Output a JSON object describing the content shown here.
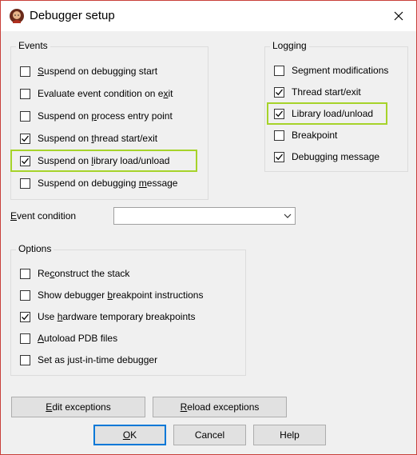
{
  "window": {
    "title": "Debugger setup"
  },
  "events": {
    "legend": "Events",
    "items": [
      {
        "pre": "",
        "u": "S",
        "post": "uspend on debugging start",
        "checked": false
      },
      {
        "pre": "Evaluate event condition on e",
        "u": "x",
        "post": "it",
        "checked": false
      },
      {
        "pre": "Suspend on ",
        "u": "p",
        "post": "rocess entry point",
        "checked": false
      },
      {
        "pre": "Suspend on ",
        "u": "t",
        "post": "hread start/exit",
        "checked": true
      },
      {
        "pre": "Suspend on ",
        "u": "l",
        "post": "ibrary load/unload",
        "checked": true
      },
      {
        "pre": "Suspend on debugging ",
        "u": "m",
        "post": "essage",
        "checked": false
      }
    ]
  },
  "logging": {
    "legend": "Logging",
    "items": [
      {
        "pre": "Segment modifications",
        "u": "",
        "post": "",
        "checked": false
      },
      {
        "pre": "Thread start/exit",
        "u": "",
        "post": "",
        "checked": true
      },
      {
        "pre": "Library load/unload",
        "u": "",
        "post": "",
        "checked": true
      },
      {
        "pre": "Breakpoint",
        "u": "",
        "post": "",
        "checked": false
      },
      {
        "pre": "Debugging message",
        "u": "",
        "post": "",
        "checked": true
      }
    ]
  },
  "event_condition": {
    "label_u": "E",
    "label_rest": "vent condition",
    "value": ""
  },
  "options": {
    "legend": "Options",
    "items": [
      {
        "pre": "Re",
        "u": "c",
        "post": "onstruct the stack",
        "checked": false
      },
      {
        "pre": "Show debugger ",
        "u": "b",
        "post": "reakpoint instructions",
        "checked": false
      },
      {
        "pre": "Use ",
        "u": "h",
        "post": "ardware temporary breakpoints",
        "checked": true
      },
      {
        "pre": "",
        "u": "A",
        "post": "utoload PDB files",
        "checked": false
      },
      {
        "pre": "Set as just-in-time debugger",
        "u": "",
        "post": "",
        "checked": false
      }
    ]
  },
  "buttons": {
    "edit_exceptions": {
      "u": "E",
      "rest": "dit exceptions"
    },
    "reload_exceptions": {
      "u": "R",
      "rest": "eload exceptions"
    },
    "ok": {
      "u": "O",
      "rest": "K"
    },
    "cancel": {
      "u": "",
      "rest": "Cancel"
    },
    "help": {
      "u": "",
      "rest": "Help"
    }
  },
  "colors": {
    "highlight": "#a6d32a",
    "window_border": "#c9403a",
    "default_button": "#0078d7"
  }
}
